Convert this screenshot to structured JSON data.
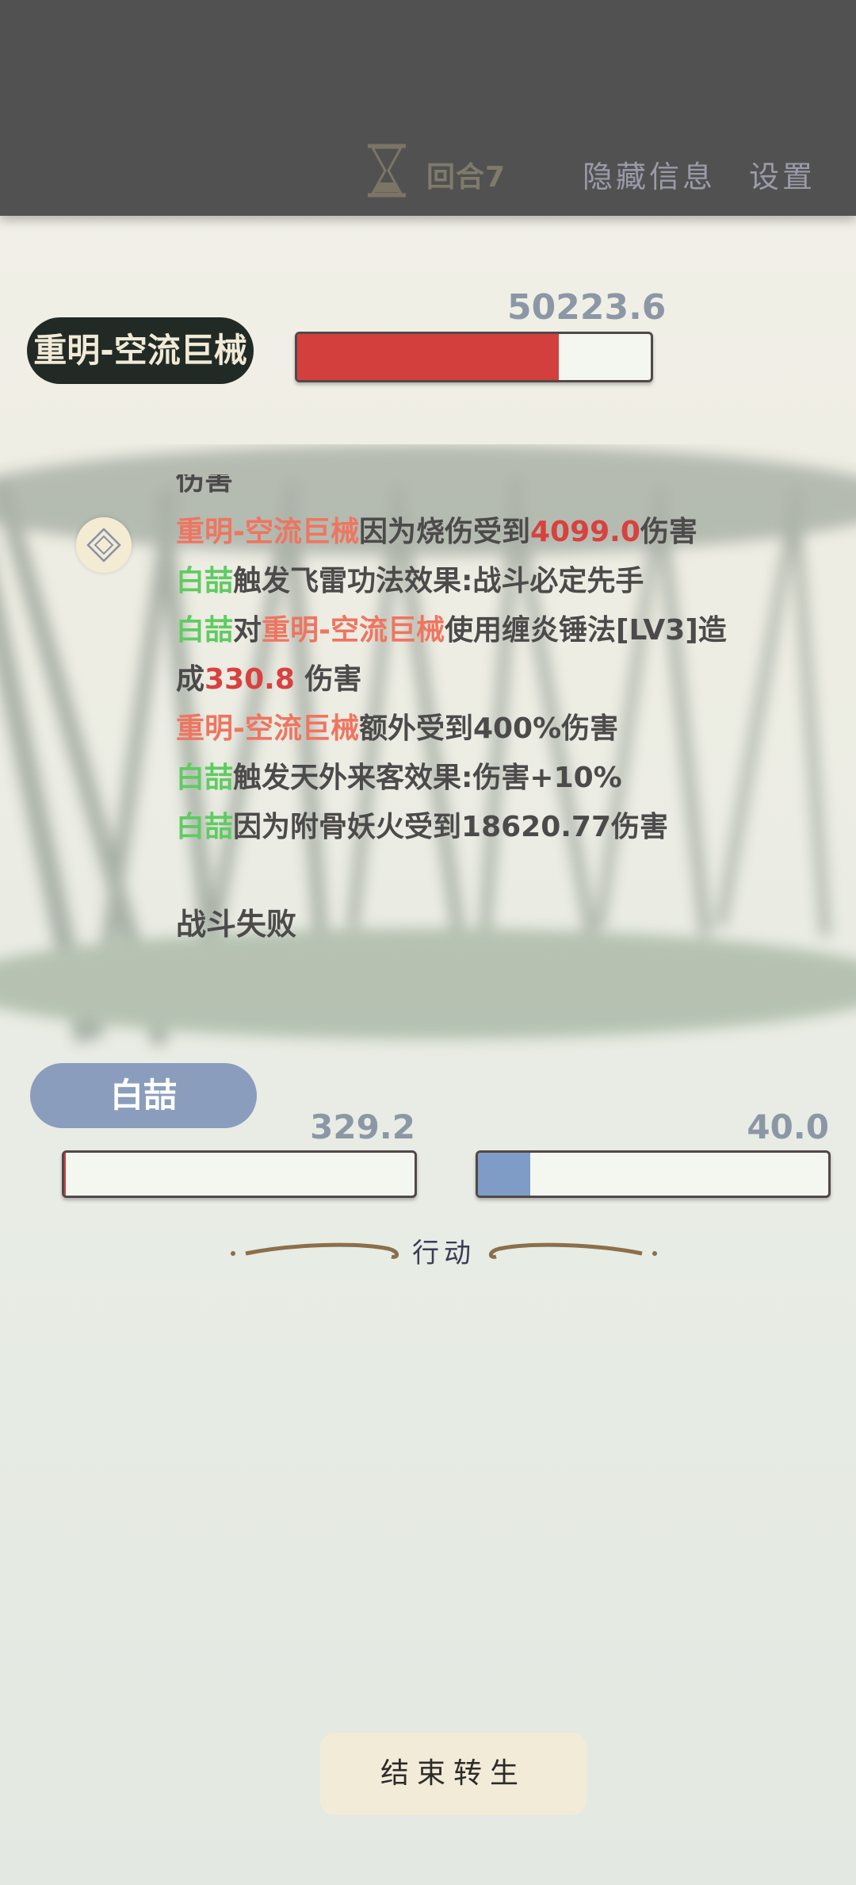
{
  "header": {
    "round_label": "回合7",
    "hide_info_label": "隐藏信息",
    "settings_label": "设置"
  },
  "enemy": {
    "name": "重明-空流巨械",
    "hp_text": "50223.6",
    "hp_fraction": 0.74
  },
  "battle_log": {
    "partial_line": "伤害",
    "lines": [
      [
        {
          "t": "重明-空流巨械",
          "c": "o"
        },
        {
          "t": "因为烧伤受到",
          "c": ""
        },
        {
          "t": "4099.0",
          "c": "r"
        },
        {
          "t": "伤害",
          "c": ""
        }
      ],
      [
        {
          "t": "白喆",
          "c": "g"
        },
        {
          "t": "触发飞雷功法效果:战斗必定先手",
          "c": ""
        }
      ],
      [
        {
          "t": "白喆",
          "c": "g"
        },
        {
          "t": "对",
          "c": ""
        },
        {
          "t": "重明-空流巨械",
          "c": "o"
        },
        {
          "t": "使用缠炎锤法[LV3]造",
          "c": ""
        }
      ],
      [
        {
          "t": "成",
          "c": ""
        },
        {
          "t": "330.8",
          "c": "r"
        },
        {
          "t": " 伤害",
          "c": ""
        }
      ],
      [
        {
          "t": "重明-空流巨械",
          "c": "o"
        },
        {
          "t": "额外受到400%伤害",
          "c": ""
        }
      ],
      [
        {
          "t": "白喆",
          "c": "g"
        },
        {
          "t": "触发天外来客效果:伤害+10%",
          "c": ""
        }
      ],
      [
        {
          "t": "白喆",
          "c": "g"
        },
        {
          "t": "因为附骨妖火受到18620.77伤害",
          "c": ""
        }
      ]
    ],
    "result": "战斗失败"
  },
  "player": {
    "name": "白喆",
    "hp_text": "329.2",
    "hp_fraction": 0.005,
    "mp_text": "40.0",
    "mp_fraction": 0.15
  },
  "action_label": "行动",
  "end_button_label": "结束转生",
  "colors": {
    "player_name": "#5fcb62",
    "enemy_name": "#ef7560",
    "damage_value": "#d8413f",
    "hp_bar": "#d33f3d",
    "mp_bar": "#7f9cc7"
  }
}
